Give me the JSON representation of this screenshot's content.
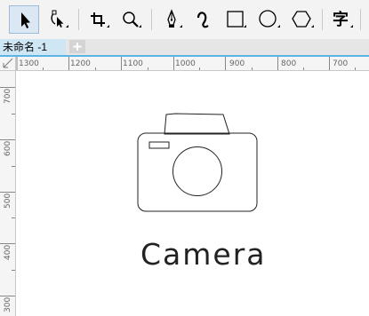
{
  "toolbar": {
    "tools": [
      {
        "name": "pick-tool-icon"
      },
      {
        "name": "shape-tool-icon"
      },
      {
        "name": "crop-tool-icon"
      },
      {
        "name": "zoom-tool-icon"
      },
      {
        "name": "pen-tool-icon"
      },
      {
        "name": "artistic-media-tool-icon"
      },
      {
        "name": "rectangle-tool-icon"
      },
      {
        "name": "ellipse-tool-icon"
      },
      {
        "name": "polygon-tool-icon"
      },
      {
        "name": "text-tool-icon"
      }
    ],
    "text_tool_glyph": "字",
    "active_tool": "pick-tool-icon"
  },
  "tabs": {
    "document_tab": "未命名 -1",
    "new_tab_glyph": "+"
  },
  "ruler": {
    "horizontal_labels": [
      "1300",
      "1200",
      "1100",
      "1000",
      "900",
      "800",
      "700"
    ],
    "vertical_labels": [
      "700",
      "600",
      "500",
      "400",
      "300"
    ]
  },
  "canvas": {
    "label": "Camera"
  },
  "colors": {
    "accent": "#5ab4e6",
    "active_tool_bg": "#dbe8f4",
    "tab_bg": "#cfe6f5"
  }
}
